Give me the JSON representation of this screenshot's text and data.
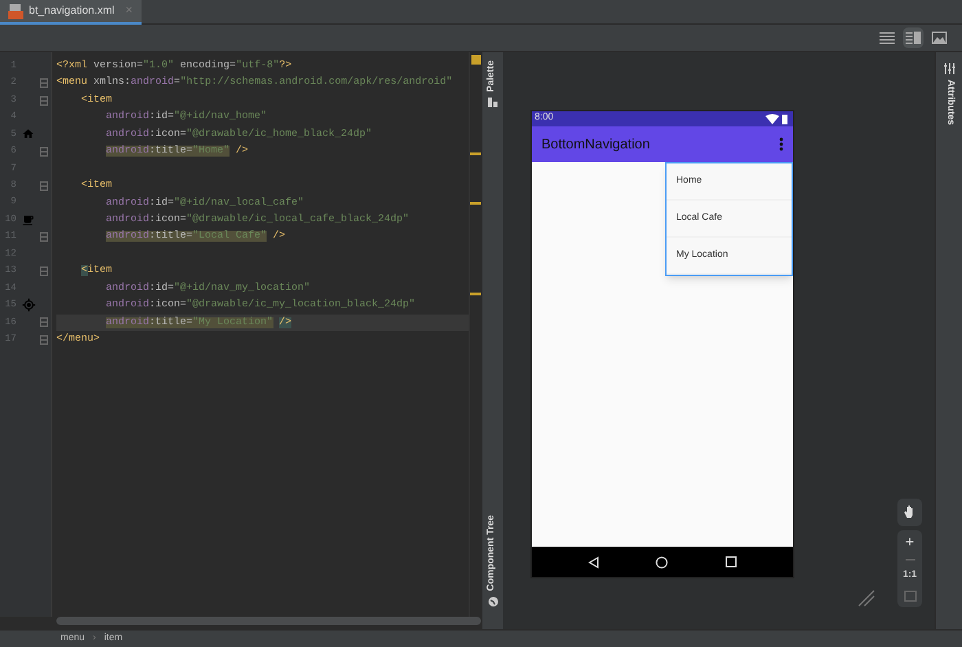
{
  "tab": {
    "label": "bt_navigation.xml",
    "close": "×",
    "selected": true
  },
  "toolbar": [
    {
      "kind": "list",
      "selected": false
    },
    {
      "kind": "split",
      "selected": true
    },
    {
      "kind": "image",
      "selected": false
    }
  ],
  "editor": {
    "lines": [
      {
        "number": "1",
        "current": false,
        "tokens": [
          {
            "kind": "tag",
            "text": "<?xml "
          },
          {
            "kind": "attr",
            "text": "version="
          },
          {
            "kind": "value",
            "text": "\"1.0\" "
          },
          {
            "kind": "attr",
            "text": "encoding="
          },
          {
            "kind": "value",
            "text": "\"utf-8\""
          },
          {
            "kind": "tag",
            "text": "?>"
          }
        ]
      },
      {
        "number": "2",
        "current": false,
        "tokens": [
          {
            "kind": "tag",
            "text": "<menu "
          },
          {
            "kind": "attr",
            "text": "xmlns:"
          },
          {
            "kind": "ns",
            "text": "android"
          },
          {
            "kind": "attr",
            "text": "="
          },
          {
            "kind": "value",
            "text": "\"http://schemas.android.com/apk/res/android\""
          }
        ],
        "children": [
          {
            "number": "3",
            "current": false,
            "tokens": [
              {
                "kind": "tag",
                "text": "<item"
              }
            ],
            "children": [
              {
                "number": "4",
                "current": false,
                "tokens": [
                  {
                    "kind": "ns",
                    "text": "android"
                  },
                  {
                    "kind": "attr",
                    "text": ":id="
                  },
                  {
                    "kind": "value",
                    "text": "\"@+id/nav_home\""
                  }
                ]
              },
              {
                "number": "5",
                "current": false,
                "tokens": [
                  {
                    "kind": "ns",
                    "text": "android"
                  },
                  {
                    "kind": "attr",
                    "text": ":icon="
                  },
                  {
                    "kind": "value",
                    "text": "\"@drawable/ic_home_black_24dp\""
                  }
                ]
              },
              {
                "number": "6",
                "current": false,
                "tokens": [
                  {
                    "kind": "highlight",
                    "tokens": [
                      {
                        "kind": "ns",
                        "text": "android"
                      },
                      {
                        "kind": "attr",
                        "text": ":title="
                      },
                      {
                        "kind": "value",
                        "text": "\"Home\""
                      }
                    ]
                  },
                  {
                    "kind": "tag",
                    "text": " />"
                  }
                ]
              }
            ]
          },
          {
            "number": "7",
            "current": false
          },
          {
            "number": "8",
            "current": false,
            "tokens": [
              {
                "kind": "tag",
                "text": "<item"
              }
            ],
            "children": [
              {
                "number": "9",
                "current": false,
                "tokens": [
                  {
                    "kind": "ns",
                    "text": "android"
                  },
                  {
                    "kind": "attr",
                    "text": ":id="
                  },
                  {
                    "kind": "value",
                    "text": "\"@+id/nav_local_cafe\""
                  }
                ]
              },
              {
                "number": "10",
                "current": false,
                "tokens": [
                  {
                    "kind": "ns",
                    "text": "android"
                  },
                  {
                    "kind": "attr",
                    "text": ":icon="
                  },
                  {
                    "kind": "value",
                    "text": "\"@drawable/ic_local_cafe_black_24dp\""
                  }
                ]
              },
              {
                "number": "11",
                "current": false,
                "tokens": [
                  {
                    "kind": "highlight",
                    "tokens": [
                      {
                        "kind": "ns",
                        "text": "android"
                      },
                      {
                        "kind": "attr",
                        "text": ":title="
                      },
                      {
                        "kind": "value",
                        "text": "\"Local Cafe\""
                      }
                    ]
                  },
                  {
                    "kind": "tag",
                    "text": " />"
                  }
                ]
              }
            ]
          },
          {
            "number": "12",
            "current": false
          },
          {
            "number": "13",
            "current": false,
            "tokens": [
              {
                "kind": "brace",
                "text": "<"
              },
              {
                "kind": "tag",
                "text": "item"
              }
            ],
            "children": [
              {
                "number": "14",
                "current": false,
                "tokens": [
                  {
                    "kind": "ns",
                    "text": "android"
                  },
                  {
                    "kind": "attr",
                    "text": ":id="
                  },
                  {
                    "kind": "value",
                    "text": "\"@+id/nav_my_location\""
                  }
                ]
              },
              {
                "number": "15",
                "current": false,
                "tokens": [
                  {
                    "kind": "ns",
                    "text": "android"
                  },
                  {
                    "kind": "attr",
                    "text": ":icon="
                  },
                  {
                    "kind": "value",
                    "text": "\"@drawable/ic_my_location_black_24dp\""
                  }
                ]
              },
              {
                "number": "16",
                "current": true,
                "tokens": [
                  {
                    "kind": "highlight",
                    "tokens": [
                      {
                        "kind": "ns",
                        "text": "android"
                      },
                      {
                        "kind": "attr",
                        "text": ":title="
                      },
                      {
                        "kind": "value",
                        "text": "\"My Location\""
                      }
                    ]
                  },
                  {
                    "kind": "closing-brace",
                    "text": "/>"
                  }
                ]
              }
            ]
          }
        ]
      },
      {
        "number": "17",
        "current": false,
        "tokens": [
          {
            "kind": "tag",
            "text": "</menu>"
          }
        ]
      }
    ]
  },
  "left_strip": {
    "top": "Palette",
    "bottom": "Component Tree"
  },
  "right_strip": {
    "label": "Attributes"
  },
  "phone": {
    "time": "8:00",
    "app_title": "BottomNavigation",
    "menu_items": [
      "Home",
      "Local Cafe",
      "My Location"
    ]
  },
  "zoom_controls": {
    "zoom_in": "+",
    "actual_size": "1:1"
  },
  "breadcrumb": {
    "items": [
      "menu",
      "item"
    ],
    "separator": "›"
  }
}
